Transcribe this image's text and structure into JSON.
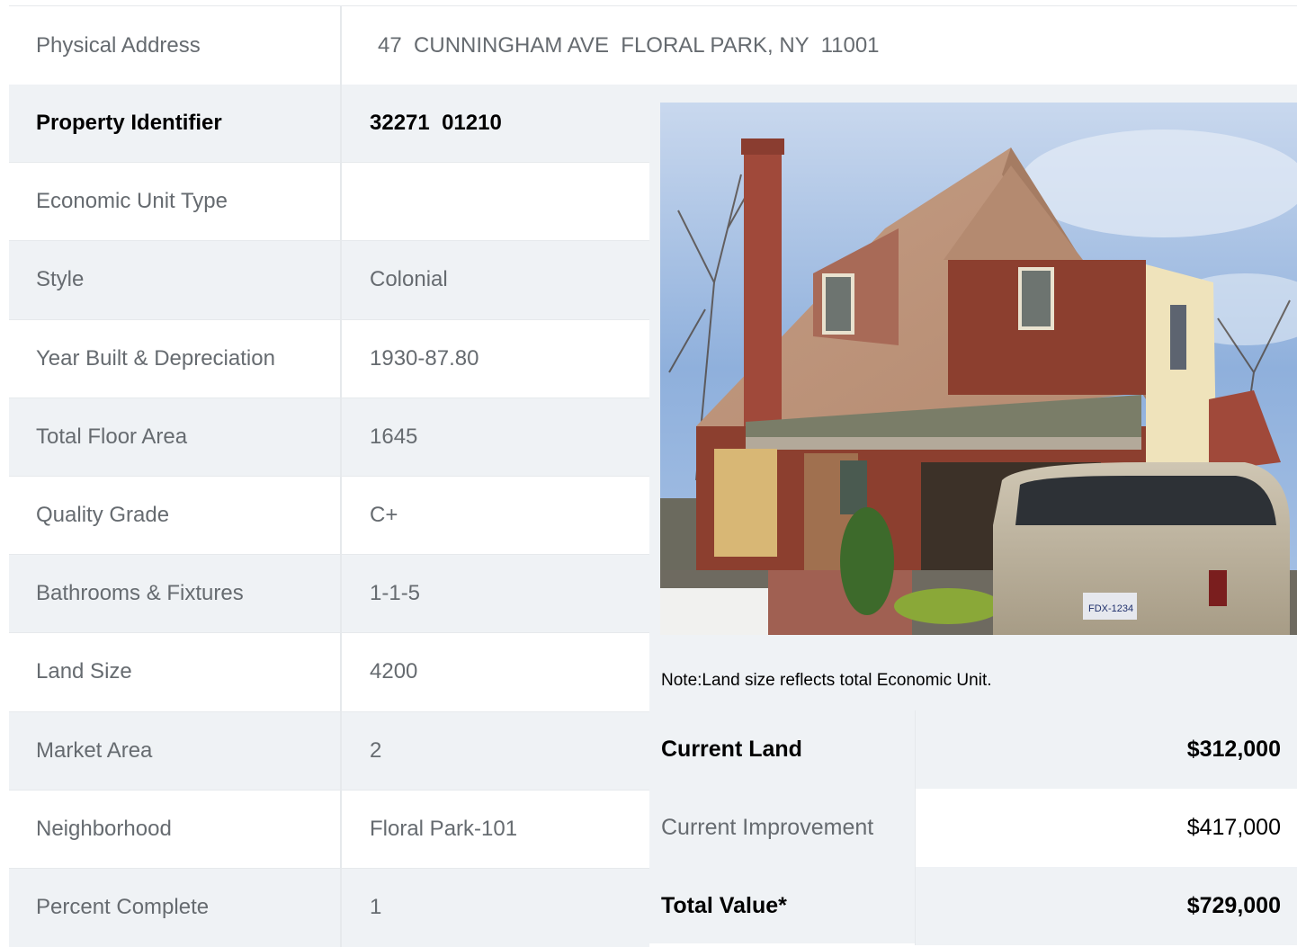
{
  "address": {
    "label": "Physical Address",
    "value": "47  CUNNINGHAM AVE  FLORAL PARK, NY  11001"
  },
  "details": [
    {
      "label": "Property Identifier",
      "value": "32271  01210"
    },
    {
      "label": "Economic Unit Type",
      "value": ""
    },
    {
      "label": "Style",
      "value": "Colonial"
    },
    {
      "label": "Year Built & Depreciation",
      "value": "1930-87.80"
    },
    {
      "label": "Total Floor Area",
      "value": "1645"
    },
    {
      "label": "Quality Grade",
      "value": "C+"
    },
    {
      "label": "Bathrooms & Fixtures",
      "value": "1-1-5"
    },
    {
      "label": "Land Size",
      "value": "4200"
    },
    {
      "label": "Market Area",
      "value": "2"
    },
    {
      "label": "Neighborhood",
      "value": "Floral Park-101"
    },
    {
      "label": "Percent Complete",
      "value": "1"
    }
  ],
  "note": "Note:Land size reflects total Economic Unit.",
  "valuation": [
    {
      "label": "Current Land",
      "value": "$312,000"
    },
    {
      "label": "Current Improvement",
      "value": "$417,000"
    },
    {
      "label": "Total Value*",
      "value": "$729,000"
    }
  ],
  "plate": "FDX-1234",
  "colors": {
    "label_text": "#666b70",
    "emphasis_text": "#000000",
    "row_shade": "#eff2f5",
    "border": "#e6e9ec"
  }
}
